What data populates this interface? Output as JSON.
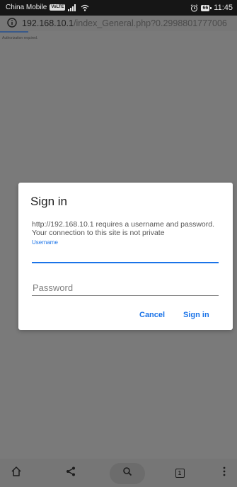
{
  "status_bar": {
    "carrier": "China Mobile",
    "volte": "VoLTE",
    "battery": "66",
    "time": "11:45"
  },
  "browser": {
    "url_host": "192.168.10.1",
    "url_path": "/index_General.php?0.2998801777006",
    "load_progress_percent": 12
  },
  "page": {
    "auth_message": "Authorization required."
  },
  "dialog": {
    "title": "Sign in",
    "message": "http://192.168.10.1 requires a username and password. Your connection to this site is not private",
    "username_label": "Username",
    "username_value": "",
    "password_placeholder": "Password",
    "password_value": "",
    "cancel_label": "Cancel",
    "signin_label": "Sign in"
  },
  "toolbar": {
    "tab_count": "1"
  },
  "colors": {
    "accent": "#1a73e8",
    "overlay": "#7a7a7a",
    "status_bar": "#161616"
  },
  "icons": [
    "info-icon",
    "signal-icon",
    "wifi-icon",
    "alarm-icon",
    "home-icon",
    "share-icon",
    "search-icon",
    "tabs-icon",
    "more-menu-icon"
  ]
}
